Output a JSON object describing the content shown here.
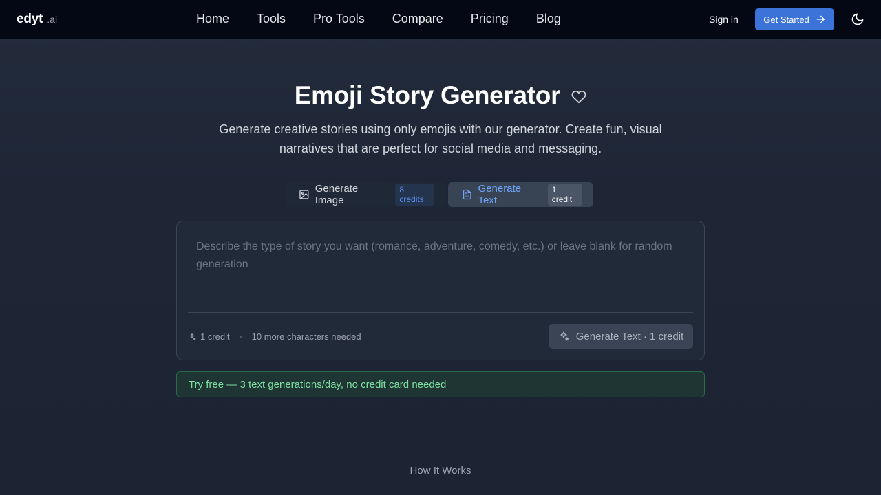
{
  "header": {
    "logo_main": "edyt",
    "logo_suffix": ".ai",
    "nav": [
      "Home",
      "Tools",
      "Pro Tools",
      "Compare",
      "Pricing",
      "Blog"
    ],
    "sign_in": "Sign in",
    "get_started": "Get Started"
  },
  "hero": {
    "title": "Emoji Story Generator",
    "subtitle": "Generate creative stories using only emojis with our generator. Create fun, visual narratives that are perfect for social media and messaging."
  },
  "tabs": {
    "image_label": "Generate Image",
    "image_cost": "8 credits",
    "text_label": "Generate Text",
    "text_cost": "1 credit",
    "active": "text"
  },
  "input": {
    "placeholder": "Describe the type of story you want (romance, adventure, comedy, etc.) or leave blank for random generation",
    "value": "",
    "credit_info": "1 credit",
    "chars_needed": "10 more characters needed",
    "generate_label": "Generate Text · 1 credit"
  },
  "banner": {
    "text": "Try free — 3 text generations/day, no credit card needed"
  },
  "section": {
    "how_it_works": "How It Works"
  },
  "colors": {
    "header_bg": "#030814",
    "accent": "#3b73d9",
    "active_tab_text": "#6fa3f7",
    "banner_text": "#7ee0a0"
  },
  "icons": {
    "theme_toggle": "moon-icon",
    "favorite": "heart-icon",
    "image_tab": "image-icon",
    "text_tab": "document-icon",
    "generate": "sparkles-icon",
    "cta": "arrow-right-icon"
  }
}
